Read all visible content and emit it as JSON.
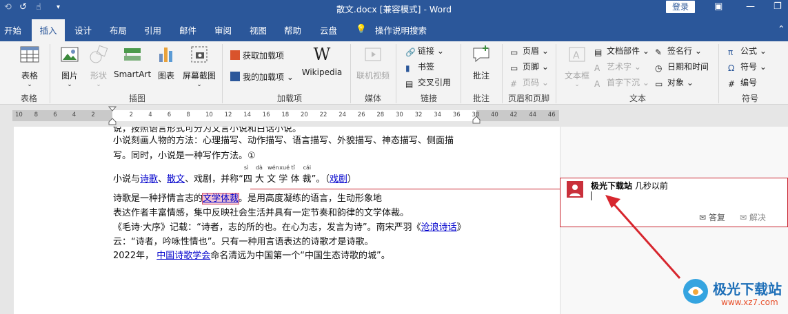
{
  "titlebar": {
    "title": "散文.docx [兼容模式]  -  Word",
    "login": "登录",
    "autosave_icon": "undo-icon",
    "touch_icon": "touch-mode-icon",
    "qa_more": "customize-icon"
  },
  "tabs": [
    "开始",
    "插入",
    "设计",
    "布局",
    "引用",
    "邮件",
    "审阅",
    "视图",
    "帮助",
    "云盘",
    "操作说明搜索"
  ],
  "active_tab": "插入",
  "ribbon": {
    "tables": {
      "button": "表格",
      "group": "表格"
    },
    "illustrations": {
      "picture": "图片",
      "shapes": "形状",
      "smartart": "SmartArt",
      "chart": "图表",
      "screenshot": "屏幕截图",
      "group": "插图"
    },
    "addins": {
      "get": "获取加载项",
      "mine": "我的加载项",
      "wiki": "Wikipedia",
      "group": "加载项"
    },
    "media": {
      "video": "联机视频",
      "group": "媒体"
    },
    "links": {
      "link": "链接",
      "bookmark": "书签",
      "crossref": "交叉引用",
      "group": "链接"
    },
    "comments": {
      "comment": "批注",
      "group": "批注"
    },
    "headerfooter": {
      "header": "页眉",
      "footer": "页脚",
      "pagenum": "页码",
      "group": "页眉和页脚"
    },
    "text": {
      "textbox": "文本框",
      "docparts": "文档部件",
      "wordart": "艺术字",
      "dropcap": "首字下沉",
      "signature": "签名行",
      "datetime": "日期和时间",
      "object": "对象",
      "group": "文本"
    },
    "symbols": {
      "equation": "公式",
      "symbol": "符号",
      "number": "编号",
      "group": "符号"
    }
  },
  "ruler": [
    "10",
    "8",
    "6",
    "4",
    "2",
    "",
    "2",
    "4",
    "6",
    "8",
    "10",
    "12",
    "14",
    "16",
    "18",
    "20",
    "22",
    "24",
    "26",
    "28",
    "30",
    "32",
    "34",
    "36",
    "38",
    "40",
    "42",
    "44",
    "46"
  ],
  "doc": {
    "l0": "说，按照语言形式可分为文言小说和白话小说。",
    "l1": "小说刻画人物的方法：心理描写、动作描写、语言描写、外貌描写、神态描写、侧面描",
    "l2": "写。同时，小说是一种写作方法。①",
    "l3a": "小说与",
    "l3b": "诗歌",
    "l3c": "、",
    "l3d": "散文",
    "l3e": "、戏剧，并称“",
    "l3f": "”。（",
    "l3g": "戏剧",
    "l3h": "）",
    "ruby": [
      {
        "rt": "sì",
        "rb": "四"
      },
      {
        "rt": "dà",
        "rb": "大"
      },
      {
        "rt": "wén",
        "rb": "文"
      },
      {
        "rt": "xué",
        "rb": "学"
      },
      {
        "rt": "tǐ",
        "rb": "体"
      },
      {
        "rt": "cái",
        "rb": "裁"
      }
    ],
    "l4a": "诗歌是一种抒情言志的",
    "l4b": "文学体裁",
    "l4c": "。是用高度凝练的语言，生动形象地",
    "l5": "表达作者丰富情感，集中反映社会生活并具有一定节奏和韵律的文学体裁。",
    "l6a": "《毛诗·大序》记载：“诗者，志的所的也。在心为志，发言为诗”。南宋严羽《",
    "l6b": "沧浪诗话",
    "l6c": "》",
    "l7": "云：“诗者，吟咏性情也”。只有一种用言语表达的诗歌才是诗歌。",
    "l8a": "2022年，",
    "l8b": "中国诗歌学会",
    "l8c": "命名清远为中国第一个“中国生态诗歌的城”。"
  },
  "comment": {
    "author": "极光下载站",
    "time": "几秒以前",
    "reply": "答复",
    "resolve": "解决"
  },
  "watermark": {
    "name": "极光下载站",
    "url": "www.xz7.com"
  },
  "colors": {
    "brand": "#2b579a",
    "comment_border": "#c8202b",
    "arrow": "#d7262e"
  }
}
